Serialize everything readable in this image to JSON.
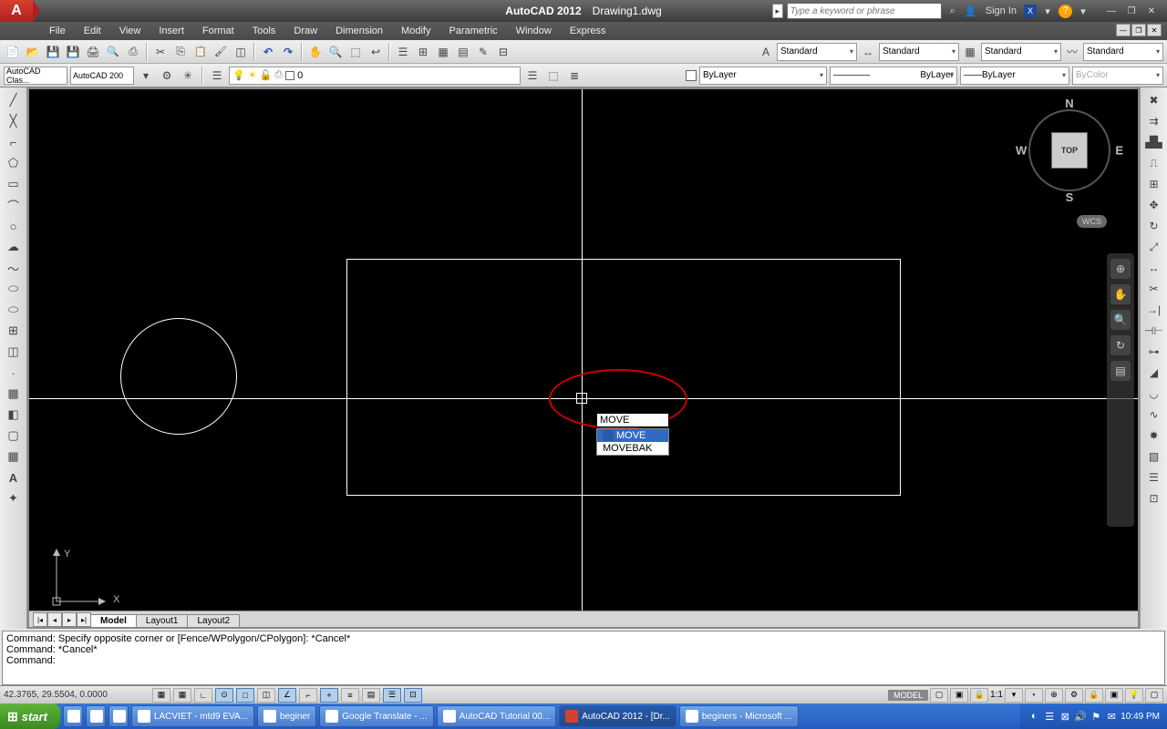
{
  "title": {
    "app": "AutoCAD 2012",
    "doc": "Drawing1.dwg"
  },
  "search_placeholder": "Type a keyword or phrase",
  "signin": "Sign In",
  "menus": [
    "File",
    "Edit",
    "View",
    "Insert",
    "Format",
    "Tools",
    "Draw",
    "Dimension",
    "Modify",
    "Parametric",
    "Window",
    "Express"
  ],
  "workspace1": "AutoCAD Clas...",
  "workspace2": "AutoCAD 200",
  "layer_current": "0",
  "style_dropdowns": {
    "text": "Standard",
    "dim": "Standard",
    "table": "Standard",
    "ml": "Standard"
  },
  "props": {
    "color": "ByLayer",
    "linetype": "ByLayer",
    "lineweight": "ByLayer",
    "plotstyle": "ByColor"
  },
  "cmd_history": [
    "Command: Specify opposite corner or [Fence/WPolygon/CPolygon]: *Cancel*",
    "Command: *Cancel*",
    "",
    "Command:"
  ],
  "dynamic_input": "MOVE",
  "autocomplete": {
    "items": [
      "MOVE",
      "MOVEBAK"
    ],
    "selected": 0
  },
  "coords": "42.3765, 29.5504, 0.0000",
  "viewcube": {
    "face": "TOP",
    "cs": "WCS"
  },
  "layout_tabs": {
    "active": "Model",
    "others": [
      "Layout1",
      "Layout2"
    ]
  },
  "status_right": {
    "space": "MODEL",
    "scale": "1:1"
  },
  "taskbar": {
    "start": "start",
    "items": [
      {
        "label": "LACVIET - mtd9 EVA..."
      },
      {
        "label": "beginer"
      },
      {
        "label": "Google Translate - ..."
      },
      {
        "label": "AutoCAD Tutorial 00..."
      },
      {
        "label": "AutoCAD 2012 - [Dr...",
        "active": true
      },
      {
        "label": "beginers - Microsoft ..."
      }
    ],
    "clock": "10:49 PM"
  }
}
